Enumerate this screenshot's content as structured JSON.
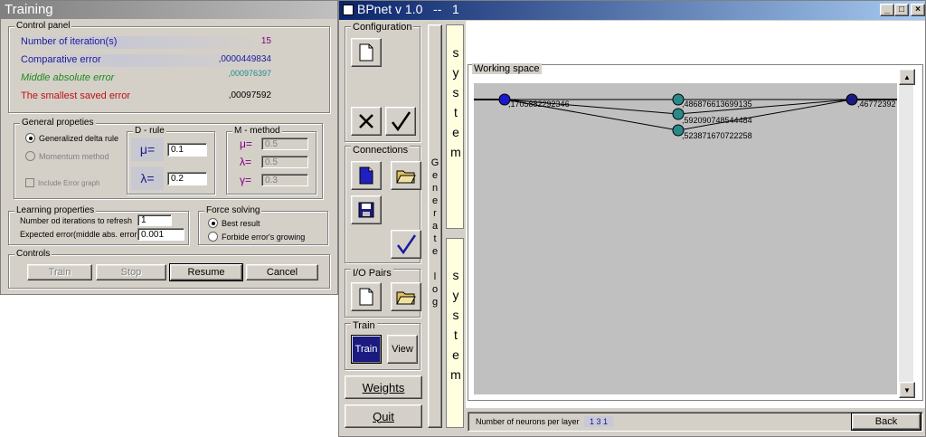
{
  "training": {
    "title": "Training",
    "control_panel": {
      "label": "Control panel",
      "rows": [
        {
          "label": "Number of iteration(s)",
          "value": "15",
          "color": "#1a1aa0",
          "value_color": "#800080"
        },
        {
          "label": "Comparative error",
          "value": ",0000449834",
          "color": "#1a1aa0",
          "value_color": "#1a1aa0"
        },
        {
          "label": "Middle absolute error",
          "value": ",000976397",
          "color": "#1f8a1f",
          "value_color": "#1f8a8a"
        },
        {
          "label": "The smallest saved error",
          "value": ",00097592",
          "color": "#c01010",
          "value_color": "#000000"
        }
      ]
    },
    "general": {
      "label": "General propeties",
      "gdr": "Generalized delta rule",
      "mm": "Momentum method",
      "include": "Include Error graph",
      "drule": {
        "label": "D - rule",
        "mu": "μ=",
        "lambda": "λ=",
        "mu_val": "0.1",
        "lambda_val": "0.2"
      },
      "mmethod": {
        "label": "M - method",
        "mu": "μ=",
        "lambda": "λ=",
        "gamma": "γ=",
        "mu_val": "0.5",
        "lambda_val": "0.5",
        "gamma_val": "0.3"
      }
    },
    "learning": {
      "label": "Learning properties",
      "iter_label": "Number od iterations to refresh",
      "iter_val": "1",
      "err_label": "Expected error(middle abs. error)",
      "err_val": "0.001"
    },
    "force": {
      "label": "Force solving",
      "best": "Best result",
      "forbid": "Forbide error's growing"
    },
    "controls": {
      "label": "Controls",
      "train": "Train",
      "stop": "Stop",
      "resume": "Resume",
      "cancel": "Cancel"
    }
  },
  "bpnet": {
    "title": "BPnet v 1.0   --   1",
    "configuration": "Configuration",
    "connections": "Connections",
    "io_pairs": "I/O Pairs",
    "train": "Train",
    "train_btn": "Train",
    "view_btn": "View",
    "weights": "Weights",
    "quit": "Quit",
    "generate_log": "Generate log",
    "load_system": "Load system",
    "save_system": "Save system",
    "working_space": "Working space",
    "neurons_label": "Number of neurons per layer",
    "neurons_value": "1 3 1",
    "back": "Back",
    "node_values": {
      "input": ",1705882292346",
      "h1": ",486876613699135",
      "h2": ",592090748544484",
      "h3": ",523871670722258",
      "output": ",46772392"
    },
    "icons": [
      "new-file-icon",
      "cancel-x-icon",
      "check-icon",
      "new-doc-icon",
      "open-folder-icon",
      "save-disk-icon",
      "check-icon",
      "new-file-icon",
      "open-folder-icon"
    ]
  }
}
